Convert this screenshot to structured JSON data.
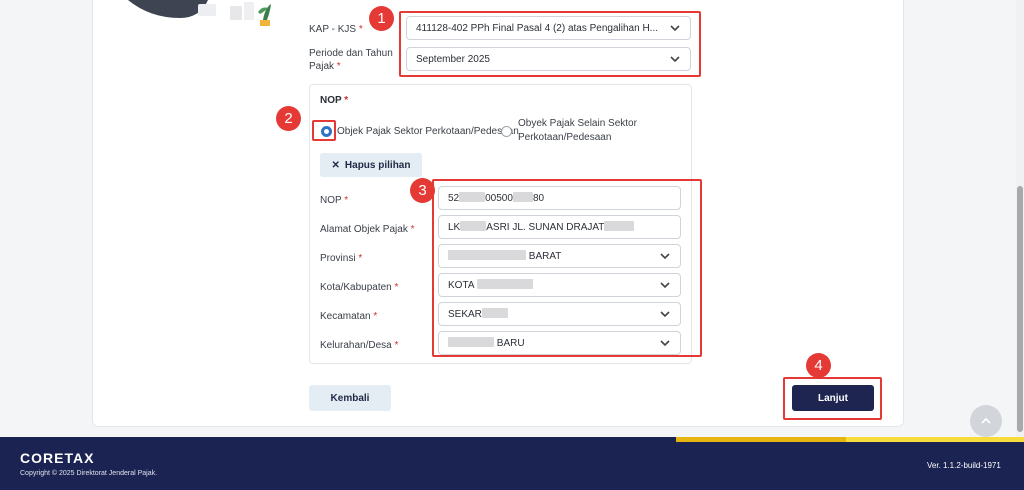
{
  "form": {
    "kap_kjs": {
      "label": "KAP - KJS",
      "required": "*",
      "value": "411128-402 PPh Final Pasal 4 (2) atas Pengalihan H..."
    },
    "periode": {
      "label_line1": "Periode dan Tahun",
      "label_line2": "Pajak",
      "required": "*",
      "value": "September 2025"
    }
  },
  "nop_section": {
    "title": "NOP",
    "required": "*",
    "option1": "Objek Pajak Sektor Perkotaan/Pedesaan",
    "option2_line1": "Obyek Pajak Selain Sektor",
    "option2_line2": "Perkotaan/Pedesaan",
    "clear_button": "Hapus pilihan",
    "clear_icon": "✕"
  },
  "fields": {
    "nop": {
      "label": "NOP",
      "required": "*",
      "part1": "52",
      "part2": "00500",
      "part3": "80"
    },
    "alamat": {
      "label": "Alamat Objek Pajak",
      "required": "*",
      "part1": "LK",
      "part2": "ASRI JL. SUNAN DRAJAT"
    },
    "provinsi": {
      "label": "Provinsi",
      "required": "*",
      "part2": "BARAT"
    },
    "kota": {
      "label": "Kota/Kabupaten",
      "required": "*",
      "part1": "KOTA"
    },
    "kecamatan": {
      "label": "Kecamatan",
      "required": "*",
      "part1": "SEKAR"
    },
    "kelurahan": {
      "label": "Kelurahan/Desa",
      "required": "*",
      "part2": "BARU"
    }
  },
  "actions": {
    "back": "Kembali",
    "next": "Lanjut"
  },
  "annotations": {
    "one": "1",
    "two": "2",
    "three": "3",
    "four": "4"
  },
  "footer": {
    "brand": "CORETAX",
    "copyright": "Copyright © 2025 Direktorat Jenderal Pajak.",
    "version": "Ver. 1.1.2-build-1971"
  },
  "colors": {
    "accent_red": "#e53935",
    "navy": "#1b2352",
    "yellow": "#f5c518",
    "radio_blue": "#2f73c9"
  }
}
